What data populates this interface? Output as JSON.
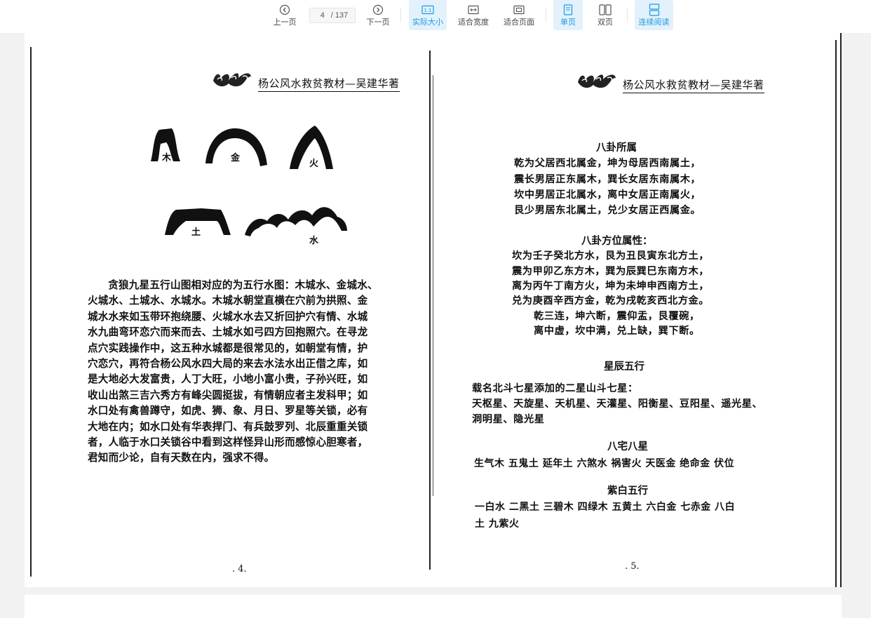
{
  "toolbar": {
    "prev_label": "上一页",
    "current_page": "4",
    "total_pages": "/ 137",
    "next_label": "下一页",
    "actual_size_label": "实际大小",
    "fit_width_label": "适合宽度",
    "fit_page_label": "适合页面",
    "single_page_label": "单页",
    "double_page_label": "双页",
    "continuous_label": "连续阅读",
    "active_color": "#1a9be0"
  },
  "left_page": {
    "header_title": "杨公风水救贫教材—吴建华著",
    "mountain_labels": [
      "木",
      "金",
      "火",
      "土",
      "水"
    ],
    "body_lines": [
      "贪狼九星五行山图相对应的为五行水图：木城水、金城水、",
      "火城水、土城水、水城水。木城水朝堂直横在穴前为拱照、金",
      "城水水来如玉带环抱绕腰、火城水水去又折回护穴有情、水城",
      "水九曲弯环恋穴而来而去、土城水如弓四方回抱照穴。在寻龙",
      "点穴实践操作中，这五种水城都是很常见的，如朝堂有情，护",
      "穴恋穴，再符合杨公风水四大局的来去水法水出正借之库，如",
      "是大地必大发富贵，人丁大旺，小地小富小贵，子孙兴旺，如",
      "收山出煞三吉六秀方有峰尖圆挺拔，有情朝应者主发科甲；如",
      "水口处有禽兽蹲守，如虎、狮、象、月日、罗星等关锁，必有",
      "大地在内；如水口处有华表捍门、有兵鼓罗列、北辰重重关锁",
      "者，人临于水口关锁谷中看到这样怪异山形而感惊心胆寒者，",
      "君知而少论，自有天数在内，强求不得。"
    ],
    "page_number": ". 4."
  },
  "right_page": {
    "header_title": "杨公风水救贫教材—吴建华著",
    "bagua_title": "八卦所属",
    "bagua_lines": [
      "乾为父居西北属金，坤为母居西南属土，",
      "震长男居正东属木，巽长女居东南属木，",
      "坎中男居正北属水，离中女居正南属火，",
      "艮少男居东北属土，兑少女居正西属金。"
    ],
    "direction_title": "八卦方位属性：",
    "direction_lines": [
      "坎为壬子癸北方水，艮为丑艮寅东北方土，",
      "震为甲卯乙东方木，巽为辰巽巳东南方木，",
      "离为丙午丁南方火，坤为未坤申西南方土，",
      "兑为庚酉辛西方金，乾为戌乾亥西北方金。"
    ],
    "rhyme_lines": [
      "乾三连，坤六断，震仰盂，艮覆碗，",
      "离中虚，坎中满，兑上缺，巽下断。"
    ],
    "star_title": "星辰五行",
    "star_lines": [
      "载名北斗七星添加的二星山斗七星：",
      "天枢星、天旋星、天机星、天灌星、阳衡星、豆阳星、遥光星、",
      "洞明星、隐光星"
    ],
    "house_title": "八宅八星",
    "house_line": "生气木  五鬼土  延年土  六煞水  祸害火  天医金  绝命金  伏位",
    "purple_title": "紫白五行",
    "purple_lines": [
      "一白水  二黑土  三碧木  四绿木  五黄土  六白金  七赤金  八白",
      "土  九紫火"
    ],
    "page_number": ". 5."
  }
}
